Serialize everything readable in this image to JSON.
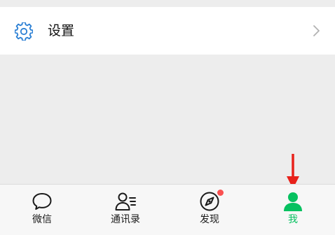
{
  "settings": {
    "label": "设置",
    "icon": "gear-icon",
    "accent_color": "#2a7fd4"
  },
  "tabbar": {
    "active_color": "#07c160",
    "tabs": [
      {
        "label": "微信",
        "icon": "chat-bubble-icon"
      },
      {
        "label": "通讯录",
        "icon": "contacts-icon"
      },
      {
        "label": "发现",
        "icon": "compass-icon",
        "badge": true
      },
      {
        "label": "我",
        "icon": "person-icon",
        "active": true
      }
    ]
  },
  "annotation": {
    "color": "#e8221b",
    "icon": "down-arrow-icon"
  }
}
